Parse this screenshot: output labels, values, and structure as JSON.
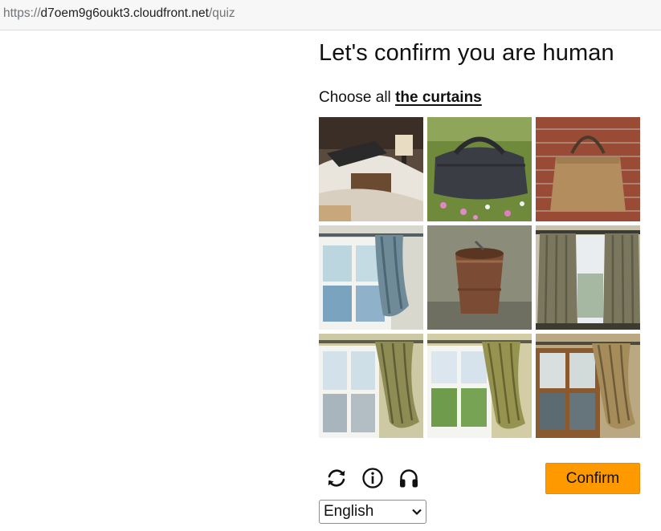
{
  "browser": {
    "url_prefix": "https://",
    "url_host": "d7oem9g6oukt3.cloudfront.net",
    "url_path": "/quiz"
  },
  "captcha": {
    "title": "Let's confirm you are human",
    "instruction_prefix": "Choose all ",
    "target": "the curtains",
    "confirm_label": "Confirm",
    "language": "English",
    "controls": [
      "refresh-icon",
      "info-icon",
      "headphones-icon"
    ],
    "tiles": [
      {
        "index": 1,
        "content": "bed"
      },
      {
        "index": 2,
        "content": "duffel-bag"
      },
      {
        "index": 3,
        "content": "tote-bag"
      },
      {
        "index": 4,
        "content": "curtain"
      },
      {
        "index": 5,
        "content": "bucket"
      },
      {
        "index": 6,
        "content": "curtain"
      },
      {
        "index": 7,
        "content": "curtain"
      },
      {
        "index": 8,
        "content": "curtain"
      },
      {
        "index": 9,
        "content": "curtain"
      }
    ]
  },
  "colors": {
    "confirm_button": "#ff9900",
    "text": "#111111"
  }
}
